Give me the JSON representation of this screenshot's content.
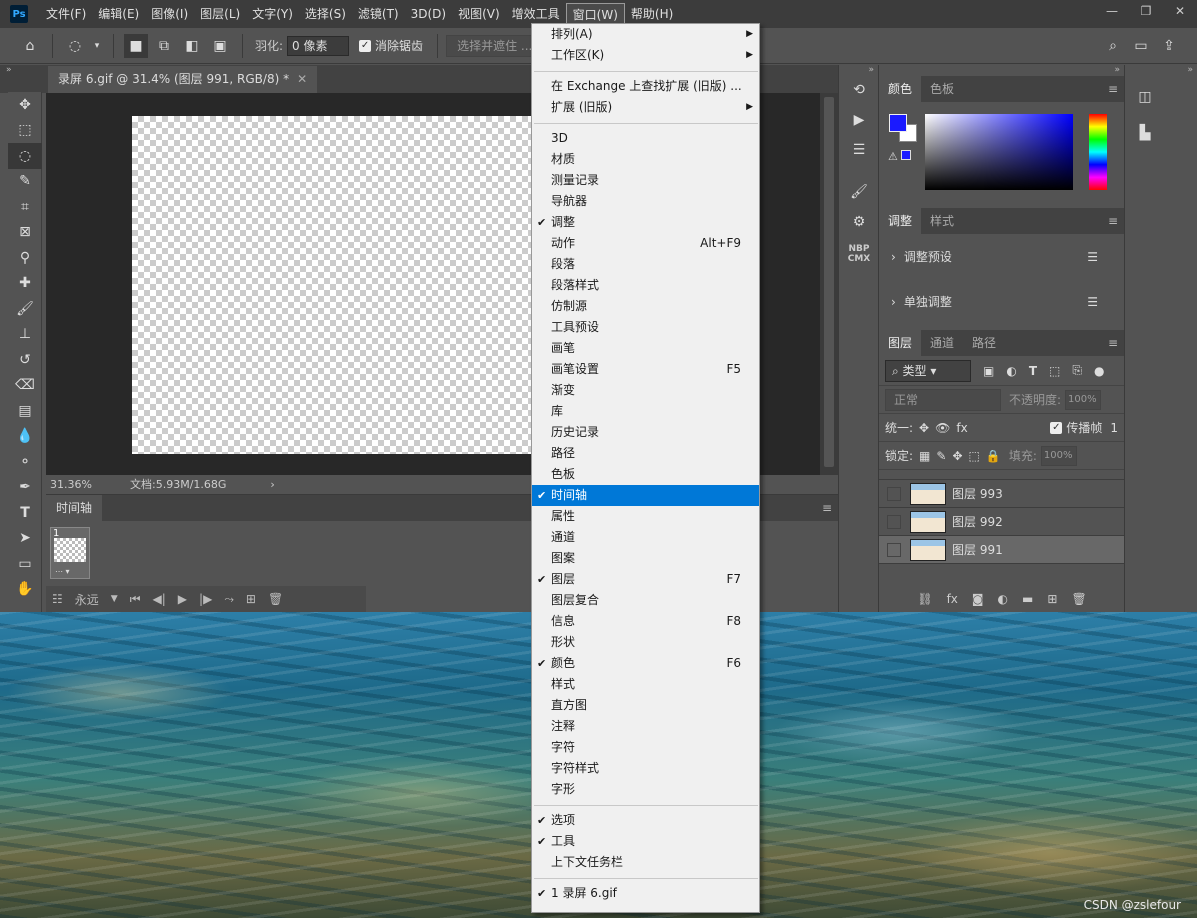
{
  "app": {
    "logo": "Ps"
  },
  "menubar": {
    "items": [
      "文件(F)",
      "编辑(E)",
      "图像(I)",
      "图层(L)",
      "文字(Y)",
      "选择(S)",
      "滤镜(T)",
      "3D(D)",
      "视图(V)",
      "增效工具",
      "窗口(W)",
      "帮助(H)"
    ],
    "active": "窗口(W)"
  },
  "window_controls": {
    "minimize": "—",
    "restore": "❐",
    "close": "✕"
  },
  "options_bar": {
    "feather_label": "羽化:",
    "feather_value": "0 像素",
    "antialias_label": "消除锯齿",
    "select_mask": "选择并遮住 ..."
  },
  "document": {
    "tab_title": "录屏 6.gif @ 31.4% (图层 991, RGB/8) *",
    "zoom": "31.36%",
    "doc_size": "文档:5.93M/1.68G"
  },
  "timeline": {
    "tab": "时间轴",
    "frame_number": "1",
    "loop": "永远"
  },
  "mid_strip": {
    "plugin_top": "NBP",
    "plugin_bottom": "CMX"
  },
  "panels": {
    "color": {
      "tab_active": "颜色",
      "tab_other": "色板",
      "foreground": "#1a1aff",
      "background": "#ffffff"
    },
    "adjustments": {
      "tab_active": "调整",
      "tab_other": "样式",
      "rows": [
        "调整预设",
        "单独调整"
      ]
    },
    "layers": {
      "tabs": [
        "图层",
        "通道",
        "路径"
      ],
      "filter": "类型",
      "blend_mode": "正常",
      "opacity_label": "不透明度:",
      "opacity_value": "100%",
      "unify_label": "统一:",
      "propagate_label": "传播帧",
      "propagate_value": "1",
      "lock_label": "锁定:",
      "fill_label": "填充:",
      "fill_value": "100%",
      "items": [
        {
          "name": "图层 993",
          "selected": false
        },
        {
          "name": "图层 992",
          "selected": false
        },
        {
          "name": "图层 991",
          "selected": true
        }
      ]
    }
  },
  "window_menu": {
    "items": [
      {
        "label": "排列(A)",
        "submenu": true
      },
      {
        "label": "工作区(K)",
        "submenu": true
      },
      {
        "sep": true
      },
      {
        "label": "在 Exchange 上查找扩展 (旧版) ..."
      },
      {
        "label": "扩展 (旧版)",
        "submenu": true
      },
      {
        "sep": true
      },
      {
        "label": "3D"
      },
      {
        "label": "材质"
      },
      {
        "label": "测量记录"
      },
      {
        "label": "导航器"
      },
      {
        "label": "调整",
        "checked": true
      },
      {
        "label": "动作",
        "shortcut": "Alt+F9"
      },
      {
        "label": "段落"
      },
      {
        "label": "段落样式"
      },
      {
        "label": "仿制源"
      },
      {
        "label": "工具预设"
      },
      {
        "label": "画笔"
      },
      {
        "label": "画笔设置",
        "shortcut": "F5"
      },
      {
        "label": "渐变"
      },
      {
        "label": "库"
      },
      {
        "label": "历史记录"
      },
      {
        "label": "路径"
      },
      {
        "label": "色板"
      },
      {
        "label": "时间轴",
        "checked": true,
        "highlighted": true
      },
      {
        "label": "属性"
      },
      {
        "label": "通道"
      },
      {
        "label": "图案"
      },
      {
        "label": "图层",
        "checked": true,
        "shortcut": "F7"
      },
      {
        "label": "图层复合"
      },
      {
        "label": "信息",
        "shortcut": "F8"
      },
      {
        "label": "形状"
      },
      {
        "label": "颜色",
        "checked": true,
        "shortcut": "F6"
      },
      {
        "label": "样式"
      },
      {
        "label": "直方图"
      },
      {
        "label": "注释"
      },
      {
        "label": "字符"
      },
      {
        "label": "字符样式"
      },
      {
        "label": "字形"
      },
      {
        "sep": true
      },
      {
        "label": "选项",
        "checked": true
      },
      {
        "label": "工具",
        "checked": true
      },
      {
        "label": "上下文任务栏"
      },
      {
        "sep": true
      },
      {
        "label": "1 录屏 6.gif",
        "checked": true
      }
    ]
  },
  "watermark": "CSDN @zslefour"
}
